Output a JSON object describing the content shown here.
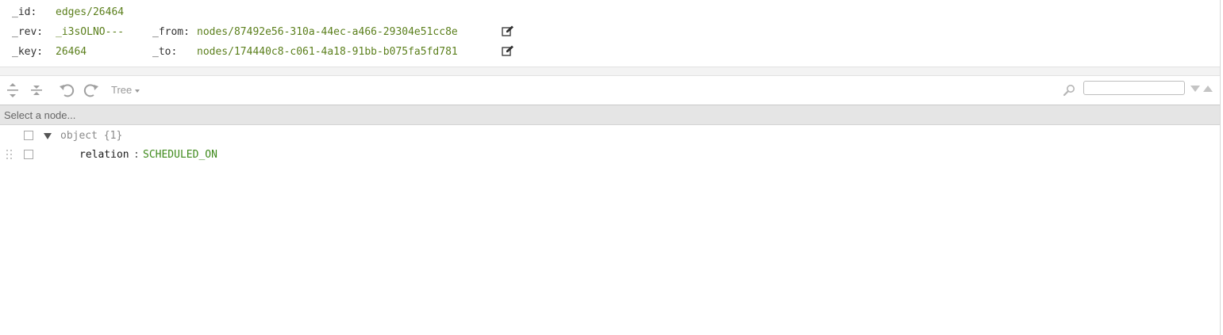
{
  "document": {
    "id_label": "_id:",
    "id_value": "edges/26464",
    "rev_label": "_rev:",
    "rev_value": "_i3sOLNO---",
    "key_label": "_key:",
    "key_value": "26464",
    "from_label": "_from:",
    "from_value": "nodes/87492e56-310a-44ec-a466-29304e51cc8e",
    "to_label": "_to:",
    "to_value": "nodes/174440c8-c061-4a18-91bb-b075fa5fd781",
    "edit_icon": "edit-icon"
  },
  "menubar": {
    "expand_all_icon": "expand-all-icon",
    "collapse_all_icon": "collapse-all-icon",
    "undo_icon": "undo-icon",
    "redo_icon": "redo-icon",
    "mode_label": "Tree",
    "search_icon": "search-icon",
    "search_value": ""
  },
  "navbar": {
    "breadcrumb": "Select a node..."
  },
  "tree": {
    "root_label": "object {1}",
    "fields": [
      {
        "key": "relation",
        "separator": ":",
        "value": "SCHEDULED_ON"
      }
    ]
  },
  "colors": {
    "value_green": "#5b7f1c",
    "tree_value_green": "#3f8a1c",
    "navbar_bg": "#e5e5e5"
  }
}
